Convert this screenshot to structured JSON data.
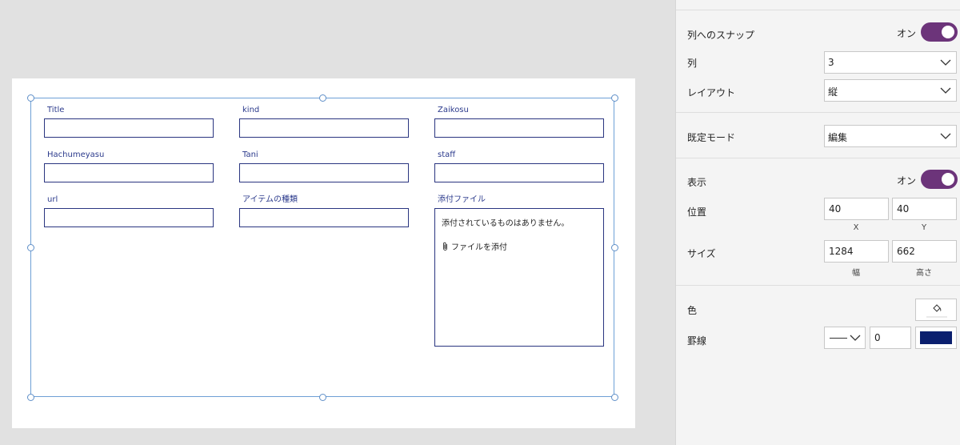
{
  "form": {
    "fields": [
      {
        "label": "Title"
      },
      {
        "label": "kind"
      },
      {
        "label": "Zaikosu"
      },
      {
        "label": "Hachumeyasu"
      },
      {
        "label": "Tani"
      },
      {
        "label": "staff"
      },
      {
        "label": "url"
      },
      {
        "label": "アイテムの種類"
      }
    ],
    "attachment": {
      "label": "添付ファイル",
      "empty_text": "添付されているものはありません。",
      "add_text": "ファイルを添付"
    }
  },
  "properties": {
    "snap_label": "列へのスナップ",
    "snap_state": "オン",
    "columns_label": "列",
    "columns_value": "3",
    "layout_label": "レイアウト",
    "layout_value": "縦",
    "default_mode_label": "既定モード",
    "default_mode_value": "編集",
    "visible_label": "表示",
    "visible_state": "オン",
    "position_label": "位置",
    "position_x": "40",
    "position_y": "40",
    "position_x_caption": "X",
    "position_y_caption": "Y",
    "size_label": "サイズ",
    "size_width": "1284",
    "size_height": "662",
    "size_width_caption": "幅",
    "size_height_caption": "高さ",
    "color_label": "色",
    "border_label": "罫線",
    "border_width": "0",
    "border_color": "#0b1f6e",
    "toggle_color": "#6c347a"
  }
}
